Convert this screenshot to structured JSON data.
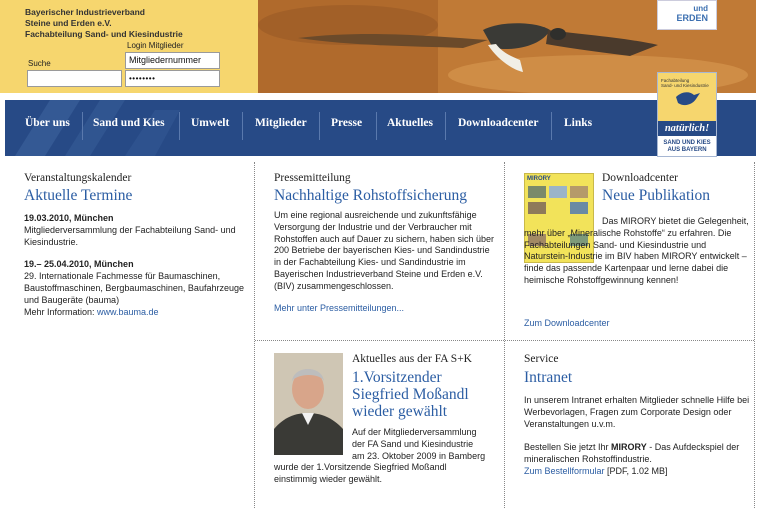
{
  "header": {
    "org_lines": [
      "Bayerischer Industrieverband",
      "Steine und Erden e.V.",
      "Fachabteilung Sand- und Kiesindustrie"
    ],
    "search_label": "Suche",
    "search_value": "",
    "login_label": "Login Mitglieder",
    "member_number_value": "Mitgliedernummer",
    "password_value": "••••••••",
    "logo_text": "ERDEN",
    "logo_text_top": "und"
  },
  "nav": {
    "items": [
      "Über uns",
      "Sand und Kies",
      "Umwelt",
      "Mitglieder",
      "Presse",
      "Aktuelles",
      "Downloadcenter",
      "Links"
    ]
  },
  "badge": {
    "top_lines": [
      "Fachabteilung",
      "Sand- und Kiesindustrie"
    ],
    "slogan": "natürlich!",
    "bottom_lines": [
      "SAND UND KIES",
      "AUS BAYERN"
    ]
  },
  "calendar": {
    "kicker": "Veranstaltungskalender",
    "headline": "Aktuelle Termine",
    "event1_title": "19.03.2010, München",
    "event1_text": "Mitgliederversammlung der Fachabteilung Sand- und Kiesindustrie.",
    "event2_title": "19.– 25.04.2010, München",
    "event2_text": "29. Internationale Fachmesse für Baumaschinen, Baustoffmaschinen, Bergbaumaschinen, Baufahrzeuge und Baugeräte (bauma)",
    "more_prefix": "Mehr Information: ",
    "more_link": "www.bauma.de"
  },
  "press": {
    "kicker": "Pressemitteilung",
    "headline": "Nachhaltige Rohstoffsicherung",
    "text": "Um eine regional ausreichende und zukunftsfähige Versorgung der Industrie und der Verbraucher mit Rohstoffen auch auf Dauer zu sichern, haben sich über 200 Betriebe der bayerischen Kies- und Sandindustrie in der Fachabteilung Kies- und Sandindustrie im Bayerischen Industrieverband Steine und Erden e.V. (BIV) zusammengeschlossen.",
    "link": "Mehr unter Pressemitteilungen..."
  },
  "download": {
    "kicker": "Downloadcenter",
    "headline": "Neue Publikation",
    "cover_title": "MIRORY",
    "text": "Das MIRORY bietet die Gelegenheit, mehr über „Mineralische Rohstoffe“ zu erfahren. Die Fachabteilungen Sand- und Kiesindustrie und Naturstein-Industrie im BIV haben MIRORY entwickelt – finde das passende Kartenpaar und lerne dabei die heimische Rohstoffgewinnung kennen!",
    "link": "Zum Downloadcenter"
  },
  "news": {
    "kicker": "Aktuelles aus der FA S+K",
    "headline_lines": [
      "1.Vorsitzender",
      "Siegfried Moßandl",
      "wieder gewählt"
    ],
    "text_lines": [
      "Auf der Mitgliederversammlung",
      "der FA Sand und Kiesindustrie",
      "am 23. Oktober 2009 in Bamberg",
      "wurde der 1.Vorsitzende Siegfried Moßandl",
      "einstimmig wieder gewählt."
    ]
  },
  "service": {
    "kicker": "Service",
    "headline": "Intranet",
    "text1": "In unserem Intranet erhalten Mitglieder schnelle Hilfe bei Werbevorlagen, Fragen zum Corporate Design oder Veranstaltungen u.v.m.",
    "text2_prefix": "Bestellen Sie jetzt Ihr ",
    "text2_bold": "MIRORY",
    "text2_suffix": " - Das Aufdeckspiel der mineralischen Rohstoffindustrie.",
    "link": "Zum Bestellformular",
    "link_suffix": " [PDF, 1.02 MB]"
  },
  "colors": {
    "header_yellow": "#f6d66e",
    "nav_blue": "#274a86",
    "link_blue": "#2b5da3"
  }
}
